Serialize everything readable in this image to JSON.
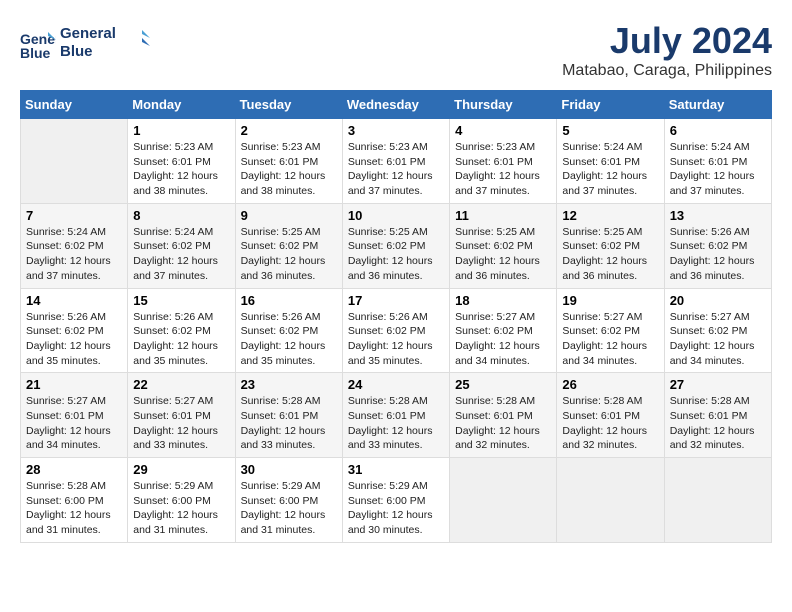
{
  "header": {
    "logo_line1": "General",
    "logo_line2": "Blue",
    "month_year": "July 2024",
    "location": "Matabao, Caraga, Philippines"
  },
  "weekdays": [
    "Sunday",
    "Monday",
    "Tuesday",
    "Wednesday",
    "Thursday",
    "Friday",
    "Saturday"
  ],
  "weeks": [
    [
      {
        "day": "",
        "info": ""
      },
      {
        "day": "1",
        "info": "Sunrise: 5:23 AM\nSunset: 6:01 PM\nDaylight: 12 hours\nand 38 minutes."
      },
      {
        "day": "2",
        "info": "Sunrise: 5:23 AM\nSunset: 6:01 PM\nDaylight: 12 hours\nand 38 minutes."
      },
      {
        "day": "3",
        "info": "Sunrise: 5:23 AM\nSunset: 6:01 PM\nDaylight: 12 hours\nand 37 minutes."
      },
      {
        "day": "4",
        "info": "Sunrise: 5:23 AM\nSunset: 6:01 PM\nDaylight: 12 hours\nand 37 minutes."
      },
      {
        "day": "5",
        "info": "Sunrise: 5:24 AM\nSunset: 6:01 PM\nDaylight: 12 hours\nand 37 minutes."
      },
      {
        "day": "6",
        "info": "Sunrise: 5:24 AM\nSunset: 6:01 PM\nDaylight: 12 hours\nand 37 minutes."
      }
    ],
    [
      {
        "day": "7",
        "info": "Sunrise: 5:24 AM\nSunset: 6:02 PM\nDaylight: 12 hours\nand 37 minutes."
      },
      {
        "day": "8",
        "info": "Sunrise: 5:24 AM\nSunset: 6:02 PM\nDaylight: 12 hours\nand 37 minutes."
      },
      {
        "day": "9",
        "info": "Sunrise: 5:25 AM\nSunset: 6:02 PM\nDaylight: 12 hours\nand 36 minutes."
      },
      {
        "day": "10",
        "info": "Sunrise: 5:25 AM\nSunset: 6:02 PM\nDaylight: 12 hours\nand 36 minutes."
      },
      {
        "day": "11",
        "info": "Sunrise: 5:25 AM\nSunset: 6:02 PM\nDaylight: 12 hours\nand 36 minutes."
      },
      {
        "day": "12",
        "info": "Sunrise: 5:25 AM\nSunset: 6:02 PM\nDaylight: 12 hours\nand 36 minutes."
      },
      {
        "day": "13",
        "info": "Sunrise: 5:26 AM\nSunset: 6:02 PM\nDaylight: 12 hours\nand 36 minutes."
      }
    ],
    [
      {
        "day": "14",
        "info": "Sunrise: 5:26 AM\nSunset: 6:02 PM\nDaylight: 12 hours\nand 35 minutes."
      },
      {
        "day": "15",
        "info": "Sunrise: 5:26 AM\nSunset: 6:02 PM\nDaylight: 12 hours\nand 35 minutes."
      },
      {
        "day": "16",
        "info": "Sunrise: 5:26 AM\nSunset: 6:02 PM\nDaylight: 12 hours\nand 35 minutes."
      },
      {
        "day": "17",
        "info": "Sunrise: 5:26 AM\nSunset: 6:02 PM\nDaylight: 12 hours\nand 35 minutes."
      },
      {
        "day": "18",
        "info": "Sunrise: 5:27 AM\nSunset: 6:02 PM\nDaylight: 12 hours\nand 34 minutes."
      },
      {
        "day": "19",
        "info": "Sunrise: 5:27 AM\nSunset: 6:02 PM\nDaylight: 12 hours\nand 34 minutes."
      },
      {
        "day": "20",
        "info": "Sunrise: 5:27 AM\nSunset: 6:02 PM\nDaylight: 12 hours\nand 34 minutes."
      }
    ],
    [
      {
        "day": "21",
        "info": "Sunrise: 5:27 AM\nSunset: 6:01 PM\nDaylight: 12 hours\nand 34 minutes."
      },
      {
        "day": "22",
        "info": "Sunrise: 5:27 AM\nSunset: 6:01 PM\nDaylight: 12 hours\nand 33 minutes."
      },
      {
        "day": "23",
        "info": "Sunrise: 5:28 AM\nSunset: 6:01 PM\nDaylight: 12 hours\nand 33 minutes."
      },
      {
        "day": "24",
        "info": "Sunrise: 5:28 AM\nSunset: 6:01 PM\nDaylight: 12 hours\nand 33 minutes."
      },
      {
        "day": "25",
        "info": "Sunrise: 5:28 AM\nSunset: 6:01 PM\nDaylight: 12 hours\nand 32 minutes."
      },
      {
        "day": "26",
        "info": "Sunrise: 5:28 AM\nSunset: 6:01 PM\nDaylight: 12 hours\nand 32 minutes."
      },
      {
        "day": "27",
        "info": "Sunrise: 5:28 AM\nSunset: 6:01 PM\nDaylight: 12 hours\nand 32 minutes."
      }
    ],
    [
      {
        "day": "28",
        "info": "Sunrise: 5:28 AM\nSunset: 6:00 PM\nDaylight: 12 hours\nand 31 minutes."
      },
      {
        "day": "29",
        "info": "Sunrise: 5:29 AM\nSunset: 6:00 PM\nDaylight: 12 hours\nand 31 minutes."
      },
      {
        "day": "30",
        "info": "Sunrise: 5:29 AM\nSunset: 6:00 PM\nDaylight: 12 hours\nand 31 minutes."
      },
      {
        "day": "31",
        "info": "Sunrise: 5:29 AM\nSunset: 6:00 PM\nDaylight: 12 hours\nand 30 minutes."
      },
      {
        "day": "",
        "info": ""
      },
      {
        "day": "",
        "info": ""
      },
      {
        "day": "",
        "info": ""
      }
    ]
  ]
}
